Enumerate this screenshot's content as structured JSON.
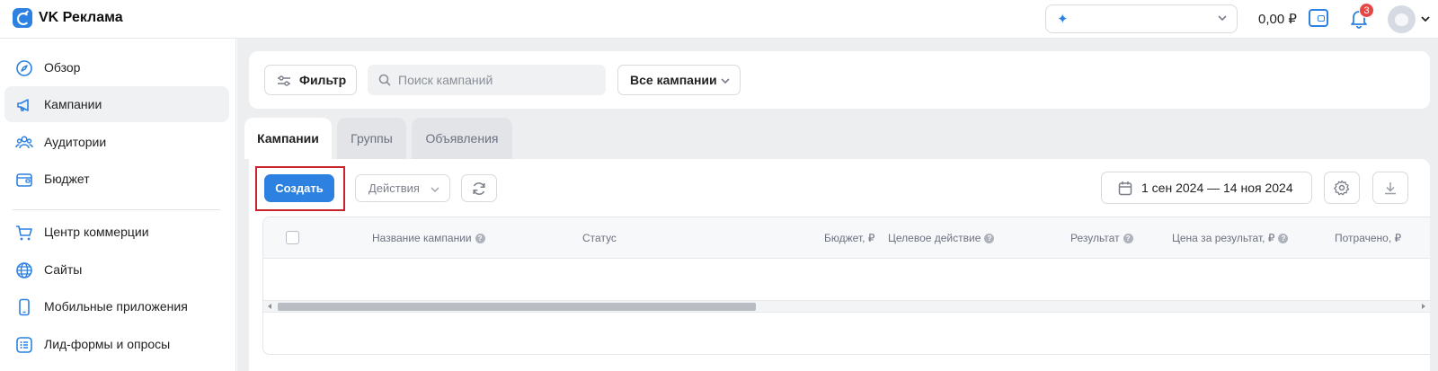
{
  "app": {
    "title": "VK Реклама"
  },
  "header": {
    "account_select": {
      "value": ""
    },
    "balance": "0,00 ₽",
    "notifications_count": "3",
    "colors": {
      "accent": "#2d81e0",
      "badge": "#e64646"
    }
  },
  "sidebar": {
    "items": [
      {
        "label": "Обзор",
        "icon": "compass-icon",
        "active": false
      },
      {
        "label": "Кампании",
        "icon": "megaphone-icon",
        "active": true
      },
      {
        "label": "Аудитории",
        "icon": "users-icon",
        "active": false
      },
      {
        "label": "Бюджет",
        "icon": "wallet-icon",
        "active": false
      },
      {
        "label": "Центр коммерции",
        "icon": "cart-icon",
        "active": false
      },
      {
        "label": "Сайты",
        "icon": "globe-icon",
        "active": false
      },
      {
        "label": "Мобильные приложения",
        "icon": "phone-icon",
        "active": false
      },
      {
        "label": "Лид-формы и опросы",
        "icon": "list-icon",
        "active": false
      }
    ]
  },
  "toolbar": {
    "filter_label": "Фильтр",
    "search_placeholder": "Поиск кампаний",
    "campaign_scope": "Все кампании"
  },
  "tabs": [
    {
      "label": "Кампании",
      "active": true
    },
    {
      "label": "Группы",
      "active": false
    },
    {
      "label": "Объявления",
      "active": false
    }
  ],
  "actions": {
    "create_label": "Создать",
    "actions_label": "Действия",
    "date_range": "1 сен 2024 — 14 ноя 2024"
  },
  "table": {
    "columns": [
      {
        "label": "Название кампании",
        "help": true
      },
      {
        "label": "Статус",
        "help": false
      },
      {
        "label": "Бюджет, ₽",
        "help": false
      },
      {
        "label": "Целевое действие",
        "help": true
      },
      {
        "label": "Результат",
        "help": true
      },
      {
        "label": "Цена за результат, ₽",
        "help": true
      },
      {
        "label": "Потрачено, ₽",
        "help": false
      }
    ],
    "rows": []
  }
}
